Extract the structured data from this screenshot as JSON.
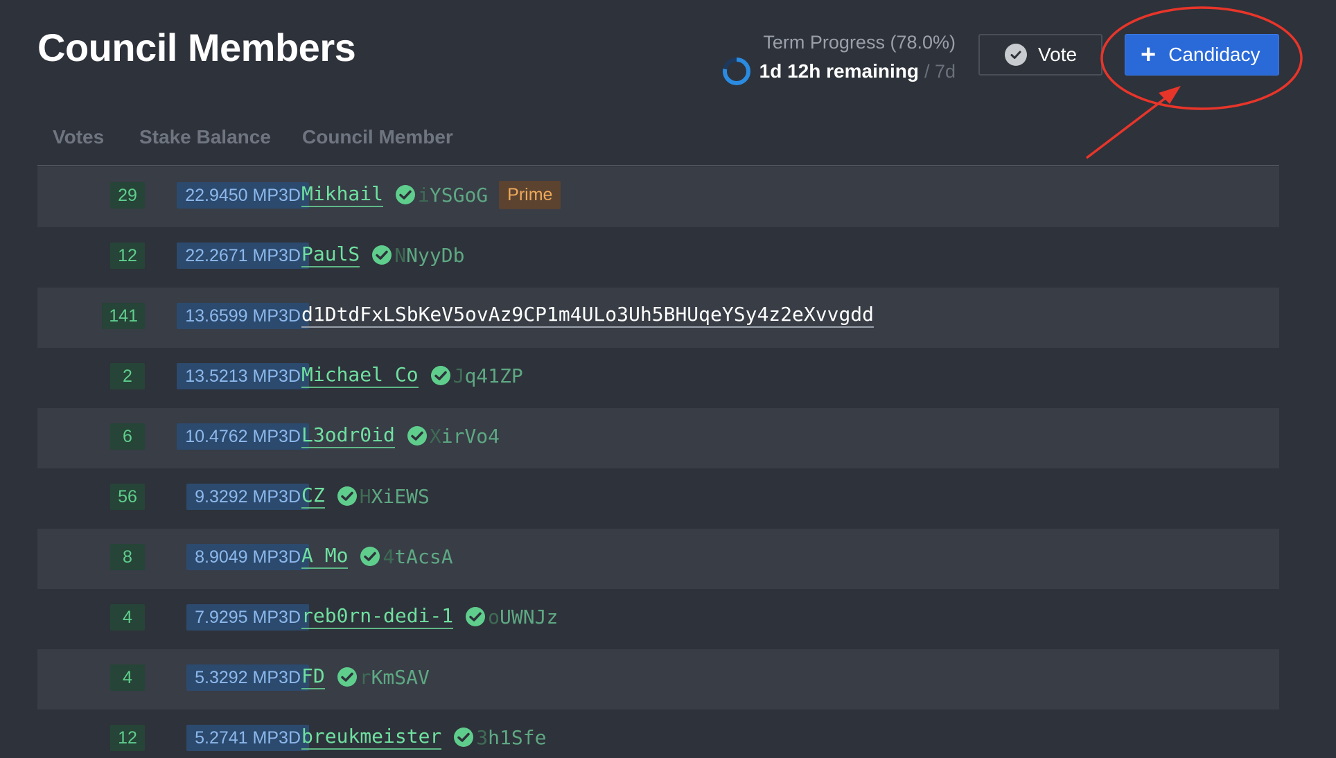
{
  "header": {
    "title": "Council Members",
    "term_label": "Term Progress (78.0%)",
    "term_progress": 0.78,
    "term_remaining": "1d 12h remaining",
    "term_total": "/ 7d"
  },
  "actions": {
    "vote_label": "Vote",
    "candidacy_label": "Candidacy"
  },
  "colors": {
    "background": "#2e323a",
    "accent": "#2a6ad8",
    "annotation": "#e8352a",
    "verified": "#5fce8d"
  },
  "table": {
    "columns": [
      "Votes",
      "Stake Balance",
      "Council Member"
    ],
    "rows": [
      {
        "votes": "29",
        "stake": "22.9450 MP3D",
        "name": "Mikhail",
        "suffix_fade": "i",
        "suffix": "YSGoG",
        "verified": true,
        "badge": "Prime"
      },
      {
        "votes": "12",
        "stake": "22.2671 MP3D",
        "name": "PaulS",
        "suffix_fade": "N",
        "suffix": "NyyDb",
        "verified": true,
        "badge": ""
      },
      {
        "votes": "141",
        "stake": "13.6599 MP3D",
        "name": "d1DtdFxLSbKeV5ovAz9CP1m4ULo3Uh5BHUqeYSy4z2eXvvgdd",
        "suffix_fade": "",
        "suffix": "",
        "verified": false,
        "badge": ""
      },
      {
        "votes": "2",
        "stake": "13.5213 MP3D",
        "name": "Michael Co",
        "suffix_fade": "J",
        "suffix": "q41ZP",
        "verified": true,
        "badge": ""
      },
      {
        "votes": "6",
        "stake": "10.4762 MP3D",
        "name": "L3odr0id",
        "suffix_fade": "X",
        "suffix": "irVo4",
        "verified": true,
        "badge": ""
      },
      {
        "votes": "56",
        "stake": "9.3292 MP3D",
        "name": "CZ",
        "suffix_fade": "H",
        "suffix": "XiEWS",
        "verified": true,
        "badge": ""
      },
      {
        "votes": "8",
        "stake": "8.9049 MP3D",
        "name": "A Mo",
        "suffix_fade": "4",
        "suffix": "tAcsA",
        "verified": true,
        "badge": ""
      },
      {
        "votes": "4",
        "stake": "7.9295 MP3D",
        "name": "reb0rn-dedi-1",
        "suffix_fade": "o",
        "suffix": "UWNJz",
        "verified": true,
        "badge": ""
      },
      {
        "votes": "4",
        "stake": "5.3292 MP3D",
        "name": "FD",
        "suffix_fade": "r",
        "suffix": "KmSAV",
        "verified": true,
        "badge": ""
      },
      {
        "votes": "12",
        "stake": "5.2741 MP3D",
        "name": "breukmeister",
        "suffix_fade": "3",
        "suffix": "h1Sfe",
        "verified": true,
        "badge": ""
      }
    ]
  }
}
